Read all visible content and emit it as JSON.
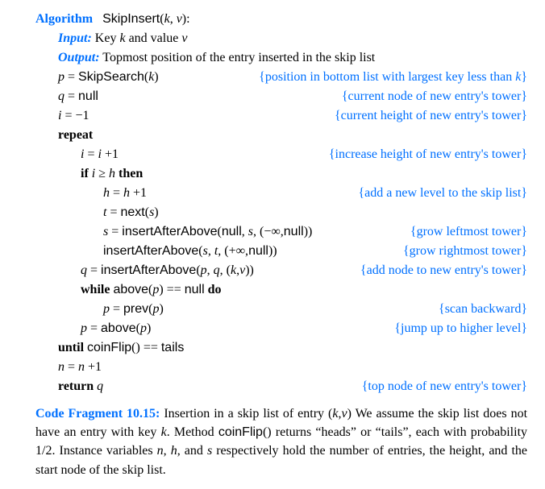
{
  "header": {
    "algword": "Algorithm",
    "algname": "SkipInsert",
    "algargs_open": "(",
    "k": "k",
    "comma": ", ",
    "v": "v",
    "algargs_close": "):",
    "inputword": "Input:",
    "inputtext_a": " Key ",
    "inputtext_b": " and value ",
    "outputword": "Output:",
    "outputtext": " Topmost position of the entry inserted in the skip list"
  },
  "lines": {
    "l1_left_a": "p",
    "l1_left_b": " = ",
    "l1_left_c": "SkipSearch",
    "l1_left_d": "(",
    "l1_left_e": "k",
    "l1_left_f": ")",
    "l1_right": "{position in bottom list with largest key less than k}",
    "l2_left_a": "q",
    "l2_left_b": " = ",
    "l2_left_c": "null",
    "l2_right": "{current node of new entry's tower}",
    "l3_left_a": "i",
    "l3_left_b": " = −1",
    "l3_right": "{current height of new entry's tower}",
    "l4_repeat": "repeat",
    "l5_left_a": "i",
    "l5_left_b": " = ",
    "l5_left_c": "i",
    "l5_left_d": " +1",
    "l5_right": "{increase height of new entry's tower}",
    "l6_if": "if ",
    "l6_a": "i",
    "l6_b": " ≥ ",
    "l6_c": "h",
    "l6_then": " then",
    "l7_left_a": "h",
    "l7_left_b": " = ",
    "l7_left_c": "h",
    "l7_left_d": " +1",
    "l7_right": "{add a new level to the skip list}",
    "l8_left_a": "t",
    "l8_left_b": " = ",
    "l8_left_c": "next",
    "l8_left_d": "(",
    "l8_left_e": "s",
    "l8_left_f": ")",
    "l9_left_a": "s",
    "l9_left_b": " = ",
    "l9_left_c": "insertAfterAbove",
    "l9_left_d": "(",
    "l9_left_e": "null",
    "l9_left_f": ", ",
    "l9_left_g": "s",
    "l9_left_h": ", (−∞,",
    "l9_left_i": "null",
    "l9_left_j": "))",
    "l9_right": "{grow leftmost tower}",
    "l10_left_a": "insertAfterAbove",
    "l10_left_b": "(",
    "l10_left_c": "s",
    "l10_left_d": ", ",
    "l10_left_e": "t",
    "l10_left_f": ", (+∞,",
    "l10_left_g": "null",
    "l10_left_h": "))",
    "l10_right": "{grow rightmost tower}",
    "l11_left_a": "q",
    "l11_left_b": " = ",
    "l11_left_c": "insertAfterAbove",
    "l11_left_d": "(",
    "l11_left_e": "p",
    "l11_left_f": ", ",
    "l11_left_g": "q",
    "l11_left_h": ", (",
    "l11_left_i": "k",
    "l11_left_j": ",",
    "l11_left_k": "v",
    "l11_left_l": "))",
    "l11_right": "{add node to new entry's tower}",
    "l12_while": "while ",
    "l12_a": "above",
    "l12_b": "(",
    "l12_c": "p",
    "l12_d": ") == ",
    "l12_e": "null",
    "l12_do": " do",
    "l13_left_a": "p",
    "l13_left_b": " = ",
    "l13_left_c": "prev",
    "l13_left_d": "(",
    "l13_left_e": "p",
    "l13_left_f": ")",
    "l13_right": "{scan backward}",
    "l14_left_a": "p",
    "l14_left_b": " = ",
    "l14_left_c": "above",
    "l14_left_d": "(",
    "l14_left_e": "p",
    "l14_left_f": ")",
    "l14_right": "{jump up to higher level}",
    "l15_until": "until ",
    "l15_a": "coinFlip",
    "l15_b": "() == ",
    "l15_c": "tails",
    "l16_a": "n",
    "l16_b": " = ",
    "l16_c": "n",
    "l16_d": " +1",
    "l17_return": "return ",
    "l17_a": "q",
    "l17_right": "{top node of new entry's tower}"
  },
  "caption": {
    "tag": "Code Fragment 10.15:",
    "t1": " Insertion in a skip list of entry (",
    "k": "k",
    "mid": ",",
    "v": "v",
    "t2": ") We assume the skip list does not have an entry with key ",
    "t3": ".  Method ",
    "cf": "coinFlip",
    "t4": "() returns “heads” or “tails”, each with probability 1/2.  Instance variables ",
    "nvar": "n",
    "c1": ", ",
    "hvar": "h",
    "c2": ", and ",
    "svar": "s",
    "t5": " respectively hold the number of entries, the height, and the start node of the skip list."
  }
}
